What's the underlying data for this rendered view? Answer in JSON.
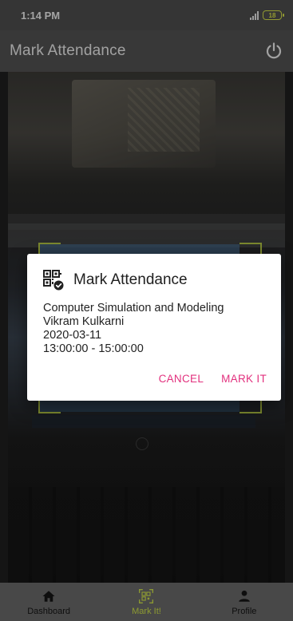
{
  "status_bar": {
    "time": "1:14 PM",
    "battery": "18",
    "icons": [
      "signal-icon",
      "battery-icon"
    ]
  },
  "app_bar": {
    "title": "Mark Attendance",
    "icons": [
      "power-icon"
    ]
  },
  "dialog": {
    "title": "Mark Attendance",
    "icon": "qr-code-icon",
    "course": "Computer Simulation and Modeling",
    "instructor": "Vikram Kulkarni",
    "date": "2020-03-11",
    "time_range": "13:00:00 - 15:00:00",
    "cancel_label": "CANCEL",
    "confirm_label": "MARK IT",
    "accent_color": "#e2317e"
  },
  "bottom_nav": {
    "active_color": "#cfe24a",
    "items": [
      {
        "label": "Dashboard",
        "icon": "home-icon"
      },
      {
        "label": "Mark It!",
        "icon": "qr-scan-icon"
      },
      {
        "label": "Profile",
        "icon": "person-icon"
      }
    ]
  }
}
